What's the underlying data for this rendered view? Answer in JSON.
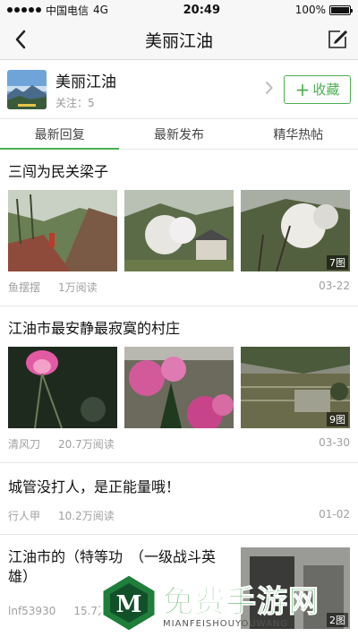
{
  "status": {
    "carrier": "中国电信",
    "network": "4G",
    "time": "20:49",
    "battery": "100%",
    "battery_level": 1.0
  },
  "nav": {
    "title": "美丽江油",
    "back_icon": "back-arrow-icon",
    "edit_icon": "edit-icon"
  },
  "forum": {
    "name": "美丽江油",
    "followers": "关注：5",
    "fav_label": "收藏",
    "fav_plus": "+"
  },
  "tabs": [
    {
      "label": "最新回复",
      "active": true
    },
    {
      "label": "最新发布",
      "active": false
    },
    {
      "label": "精华热帖",
      "active": false
    }
  ],
  "posts": [
    {
      "title": "三闯为民关梁子",
      "author": "鱼摆摆",
      "views": "1万阅读",
      "date": "03-22",
      "img_count": "7图"
    },
    {
      "title": "江油市最安静最寂寞的村庄",
      "author": "清风刀",
      "views": "20.7万阅读",
      "date": "03-30",
      "img_count": "9图"
    },
    {
      "title": "城管没打人，是正能量哦！",
      "author": "行人甲",
      "views": "10.2万阅读",
      "date": "01-02"
    },
    {
      "title": "江油市的（特等功　（一级战斗英雄）",
      "author": "lnf53930",
      "views": "15.7万阅读",
      "date": "",
      "img_count": "2图"
    }
  ],
  "watermark": {
    "cn": "免费手游网",
    "en": "MIANFEISHOUYOUWANG",
    "logo_letter": "M"
  },
  "colors": {
    "accent": "#4caf50",
    "meta": "#a0a0a0"
  }
}
